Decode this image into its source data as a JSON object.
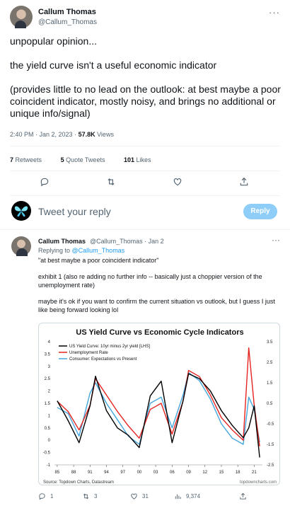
{
  "tweet": {
    "author_name": "Callum Thomas",
    "author_handle": "@Callum_Thomas",
    "more": "···",
    "text": [
      "unpopular opinion...",
      "the yield curve isn't a useful economic indicator",
      "(provides little to no lead on the outlook: at best maybe a poor coincident indicator, mostly noisy, and brings no additional or unique info/signal)"
    ],
    "time": "2:40 PM · Jan 2, 2023 · ",
    "views_count": "57.8K",
    "views_label": " Views",
    "stats": {
      "retweets_count": "7",
      "retweets_label": " Retweets",
      "quotes_count": "5",
      "quotes_label": " Quote Tweets",
      "likes_count": "101",
      "likes_label": " Likes"
    }
  },
  "reply_box": {
    "placeholder": "Tweet your reply",
    "button_label": "Reply"
  },
  "reply": {
    "author_name": "Callum Thomas",
    "meta": "@Callum_Thomas · Jan 2",
    "more": "···",
    "replying_prefix": "Replying to ",
    "replying_handle": "@Callum_Thomas",
    "text": [
      "\"at best maybe a poor coincident indicator\"",
      "exhibit 1 (also re adding no further info -- basically just a choppier version of the unemployment rate)",
      "maybe it's ok if you want to confirm the current situation vs outlook, but I guess I just like being forward looking lol"
    ],
    "actions": {
      "replies": "1",
      "retweets": "3",
      "likes": "31",
      "views": "9,374"
    }
  },
  "chart_data": {
    "type": "line",
    "title": "US Yield Curve vs Economic Cycle Indicators",
    "source": "Source: Topdown Charts, Datastream",
    "watermark": "topdowncharts.com",
    "x": [
      1985,
      1987,
      1989,
      1991,
      1992,
      1994,
      1996,
      1998,
      2000,
      2002,
      2004,
      2006,
      2008,
      2009,
      2011,
      2013,
      2015,
      2017,
      2019,
      2020,
      2021,
      2022
    ],
    "x_tick_labels": [
      "85",
      "88",
      "91",
      "94",
      "97",
      "00",
      "03",
      "06",
      "09",
      "12",
      "15",
      "18",
      "21"
    ],
    "x_ticks": [
      1985,
      1988,
      1991,
      1994,
      1997,
      2000,
      2003,
      2006,
      2009,
      2012,
      2015,
      2018,
      2021
    ],
    "ylim_left": [
      -1,
      4
    ],
    "left_tick_labels": [
      "4",
      "3.5",
      "3",
      "2.5",
      "2",
      "1.5",
      "1",
      "0.5",
      "0",
      "-0.5",
      "-1"
    ],
    "ylim_right": [
      -2.5,
      3.5
    ],
    "right_tick_labels": [
      "3.5",
      "2.5",
      "1.5",
      "0.5",
      "-0.5",
      "-1.5",
      "-2.5"
    ],
    "colors": {
      "yield": "#000000",
      "unemployment": "#e52420",
      "consumer": "#43a6dd"
    },
    "series": [
      {
        "name": "US Yield Curve: 10yr minus 2yr yield [LHS]",
        "axis": "left",
        "values": [
          1.6,
          0.8,
          -0.1,
          1.4,
          2.6,
          1.2,
          0.5,
          0.2,
          -0.3,
          1.8,
          2.4,
          -0.1,
          1.6,
          2.7,
          2.5,
          2.0,
          1.2,
          0.6,
          0.1,
          0.5,
          1.4,
          -0.7
        ]
      },
      {
        "name": "Unemployment Rate",
        "axis": "right",
        "values": [
          0.6,
          0.1,
          -0.8,
          0.4,
          1.7,
          0.9,
          0.1,
          -0.6,
          -1.2,
          0.2,
          0.5,
          -1.0,
          0.6,
          2.1,
          1.8,
          0.9,
          -0.2,
          -0.8,
          -1.3,
          3.2,
          0.4,
          -1.6
        ]
      },
      {
        "name": "Consumer: Expectations vs Present",
        "axis": "right",
        "values": [
          0.3,
          0.0,
          -1.1,
          1.0,
          1.5,
          0.5,
          -0.3,
          -1.1,
          -1.5,
          0.5,
          0.8,
          -0.7,
          0.9,
          2.0,
          1.6,
          0.7,
          -0.5,
          -1.2,
          -1.5,
          0.8,
          0.2,
          -1.4
        ]
      }
    ]
  }
}
